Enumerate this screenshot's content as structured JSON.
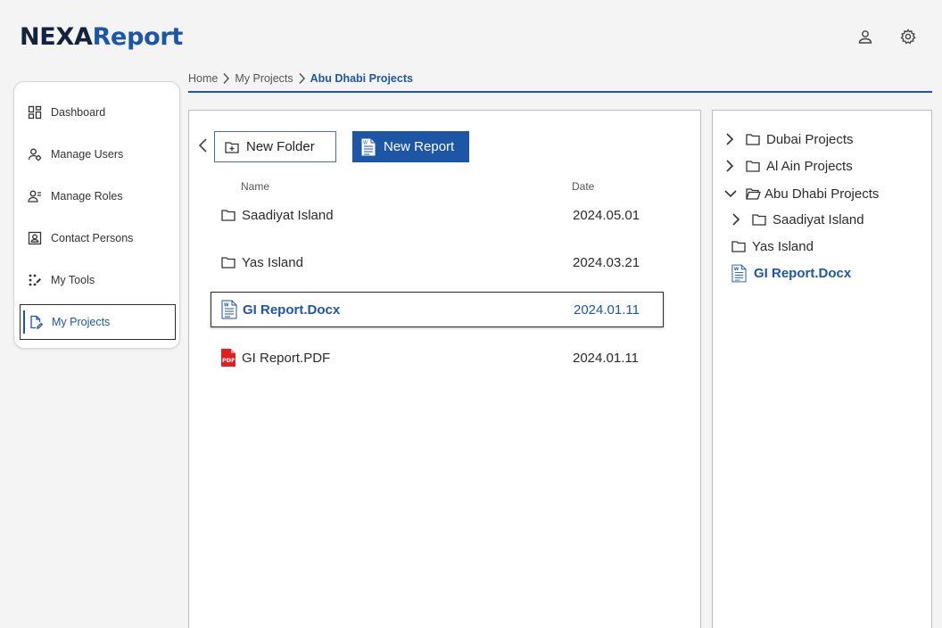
{
  "app": {
    "logo_part1": "NEXA",
    "logo_part2": "Report",
    "colors": {
      "brand": "#1e56a6",
      "dark": "#13223d",
      "pdf": "#e02020"
    }
  },
  "header_icons": [
    "user-icon",
    "settings-icon"
  ],
  "sidebar": {
    "items": [
      {
        "label": "Dashboard",
        "icon": "dashboard-icon"
      },
      {
        "label": "Manage Users",
        "icon": "manage-users-icon"
      },
      {
        "label": "Manage Roles",
        "icon": "manage-roles-icon"
      },
      {
        "label": "Contact Persons",
        "icon": "contact-persons-icon"
      },
      {
        "label": "My Tools",
        "icon": "tools-icon"
      },
      {
        "label": "My Projects",
        "icon": "projects-icon",
        "active": true
      }
    ]
  },
  "breadcrumb": [
    "Home",
    "My Projects",
    "Abu Dhabi Projects"
  ],
  "toolbar": {
    "new_folder_label": "New Folder",
    "new_report_label": "New Report"
  },
  "table": {
    "headers": {
      "name": "Name",
      "date": "Date"
    },
    "rows": [
      {
        "name": "Saadiyat Island",
        "date": "2024.05.01",
        "type": "folder"
      },
      {
        "name": "Yas Island",
        "date": "2024.03.21",
        "type": "folder"
      },
      {
        "name": "GI Report.Docx",
        "date": "2024.01.11",
        "type": "docx",
        "selected": true
      },
      {
        "name": "GI Report.PDF",
        "date": "2024.01.11",
        "type": "pdf"
      }
    ]
  },
  "tree": {
    "items": [
      {
        "label": "Dubai Projects",
        "chevron": "right",
        "type": "folder"
      },
      {
        "label": "Al Ain Projects",
        "chevron": "right",
        "type": "folder"
      },
      {
        "label": "Abu Dhabi Projects",
        "chevron": "down",
        "type": "folder-open"
      },
      {
        "label": "Saadiyat Island",
        "chevron": "right",
        "type": "folder"
      },
      {
        "label": "Yas Island",
        "chevron": "none",
        "type": "folder"
      },
      {
        "label": "GI Report.Docx",
        "chevron": "none",
        "type": "docx",
        "active": true
      }
    ]
  },
  "pdf_badge": "PDF"
}
